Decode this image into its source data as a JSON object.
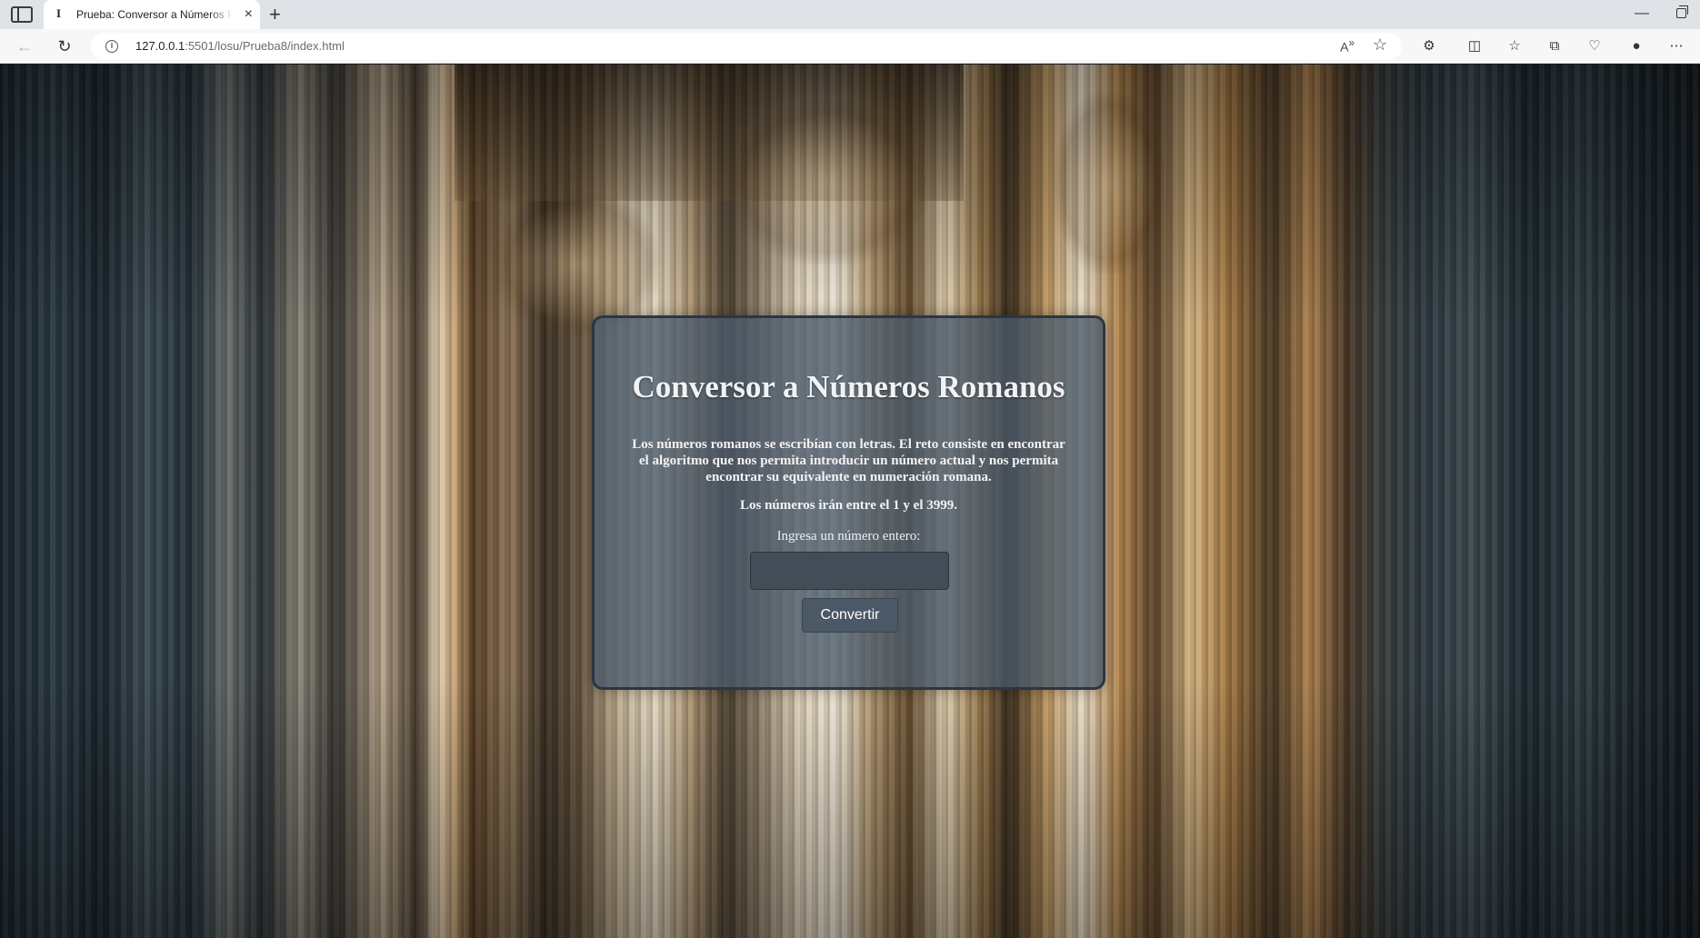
{
  "browser": {
    "tab_title": "Prueba: Conversor a Números Romanos",
    "tab_favicon": "I",
    "url_host": "127.0.0.1",
    "url_rest": ":5501/losu/Prueba8/index.html",
    "icons": [
      "sidebar-icon",
      "close-icon",
      "plus-icon",
      "back-icon",
      "reload-icon",
      "info-icon",
      "read-aloud-icon",
      "star-icon",
      "extensions-icon",
      "split-screen-icon",
      "favorites-icon",
      "collections-icon",
      "browser-essentials-icon",
      "profile-icon",
      "more-icon"
    ]
  },
  "page": {
    "title": "Conversor a Números Romanos",
    "description": "Los números romanos se escribían con letras. El reto consiste en encontrar el algoritmo que nos permita introducir un número actual y nos permita encontrar su equivalente en numeración romana.",
    "range_note": "Los números irán entre el 1 y el 3999.",
    "input_label": "Ingresa un número entero:",
    "input_value": "",
    "button_label": "Convertir"
  },
  "colors": {
    "card_bg": "#48586a",
    "card_border": "#2c3642",
    "input_bg": "#434d58",
    "button_bg": "#4b5865",
    "text": "#f1f2f4"
  }
}
